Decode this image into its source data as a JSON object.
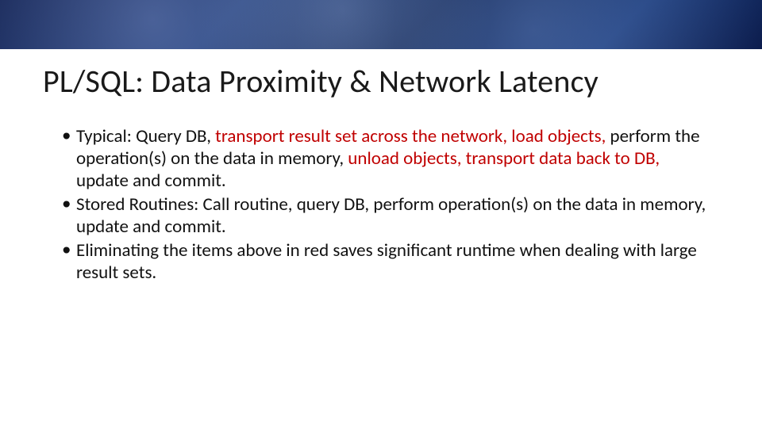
{
  "title": "PL/SQL: Data Proximity & Network Latency",
  "bullets": {
    "b1": {
      "p1": "Typical: Query DB, ",
      "p2": "transport result set across the network, load objects, ",
      "p3": "perform the operation(s) on the data in memory, ",
      "p4": "unload objects, transport data back to DB, ",
      "p5": "update and commit."
    },
    "b2": "Stored Routines: Call routine, query DB, perform operation(s) on the data in memory, update and commit.",
    "b3": "Eliminating the items above in red saves significant runtime when dealing with large result sets."
  },
  "colors": {
    "red": "#c00000"
  }
}
